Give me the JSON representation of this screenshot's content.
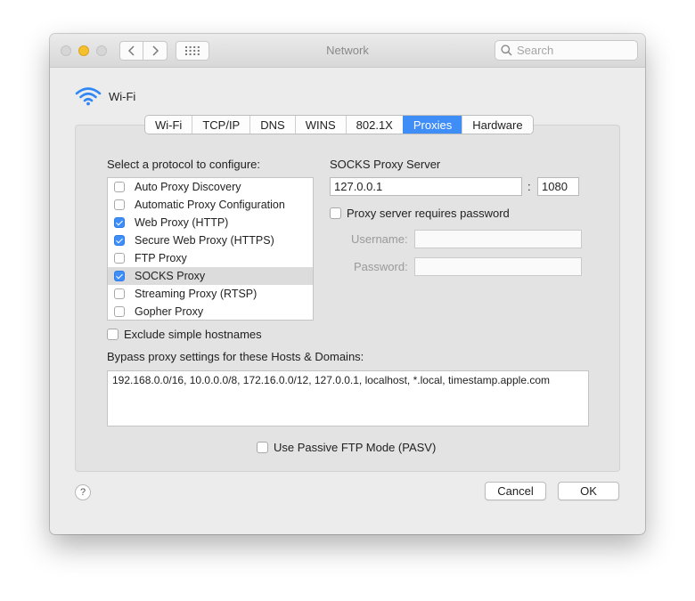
{
  "window": {
    "title": "Network"
  },
  "search": {
    "placeholder": "Search"
  },
  "header": {
    "interface_name": "Wi-Fi"
  },
  "tabs": [
    {
      "label": "Wi-Fi",
      "active": false
    },
    {
      "label": "TCP/IP",
      "active": false
    },
    {
      "label": "DNS",
      "active": false
    },
    {
      "label": "WINS",
      "active": false
    },
    {
      "label": "802.1X",
      "active": false
    },
    {
      "label": "Proxies",
      "active": true
    },
    {
      "label": "Hardware",
      "active": false
    }
  ],
  "protocols": {
    "heading": "Select a protocol to configure:",
    "items": [
      {
        "label": "Auto Proxy Discovery",
        "checked": false
      },
      {
        "label": "Automatic Proxy Configuration",
        "checked": false
      },
      {
        "label": "Web Proxy (HTTP)",
        "checked": true
      },
      {
        "label": "Secure Web Proxy (HTTPS)",
        "checked": true
      },
      {
        "label": "FTP Proxy",
        "checked": false
      },
      {
        "label": "SOCKS Proxy",
        "checked": true,
        "selected": true
      },
      {
        "label": "Streaming Proxy (RTSP)",
        "checked": false
      },
      {
        "label": "Gopher Proxy",
        "checked": false
      }
    ]
  },
  "proxy_server": {
    "heading": "SOCKS Proxy Server",
    "address": "127.0.0.1",
    "separator": ":",
    "port": "1080",
    "requires_password_label": "Proxy server requires password",
    "requires_password": false,
    "username_label": "Username:",
    "username_value": "",
    "password_label": "Password:",
    "password_value": ""
  },
  "exclude_simple": {
    "label": "Exclude simple hostnames",
    "checked": false
  },
  "bypass": {
    "label": "Bypass proxy settings for these Hosts & Domains:",
    "value": "192.168.0.0/16, 10.0.0.0/8, 172.16.0.0/12, 127.0.0.1, localhost, *.local, timestamp.apple.com"
  },
  "passive_ftp": {
    "label": "Use Passive FTP Mode (PASV)",
    "checked": false
  },
  "footer": {
    "help_label": "?",
    "cancel_label": "Cancel",
    "ok_label": "OK"
  },
  "colors": {
    "accent": "#3f8ef8",
    "wifi_icon": "#2f86f5",
    "minimize": "#f5c02c"
  },
  "icons": {
    "wifi": "wifi-icon",
    "back": "chevron-left-icon",
    "forward": "chevron-right-icon",
    "grid": "grid-icon",
    "search": "search-icon"
  }
}
